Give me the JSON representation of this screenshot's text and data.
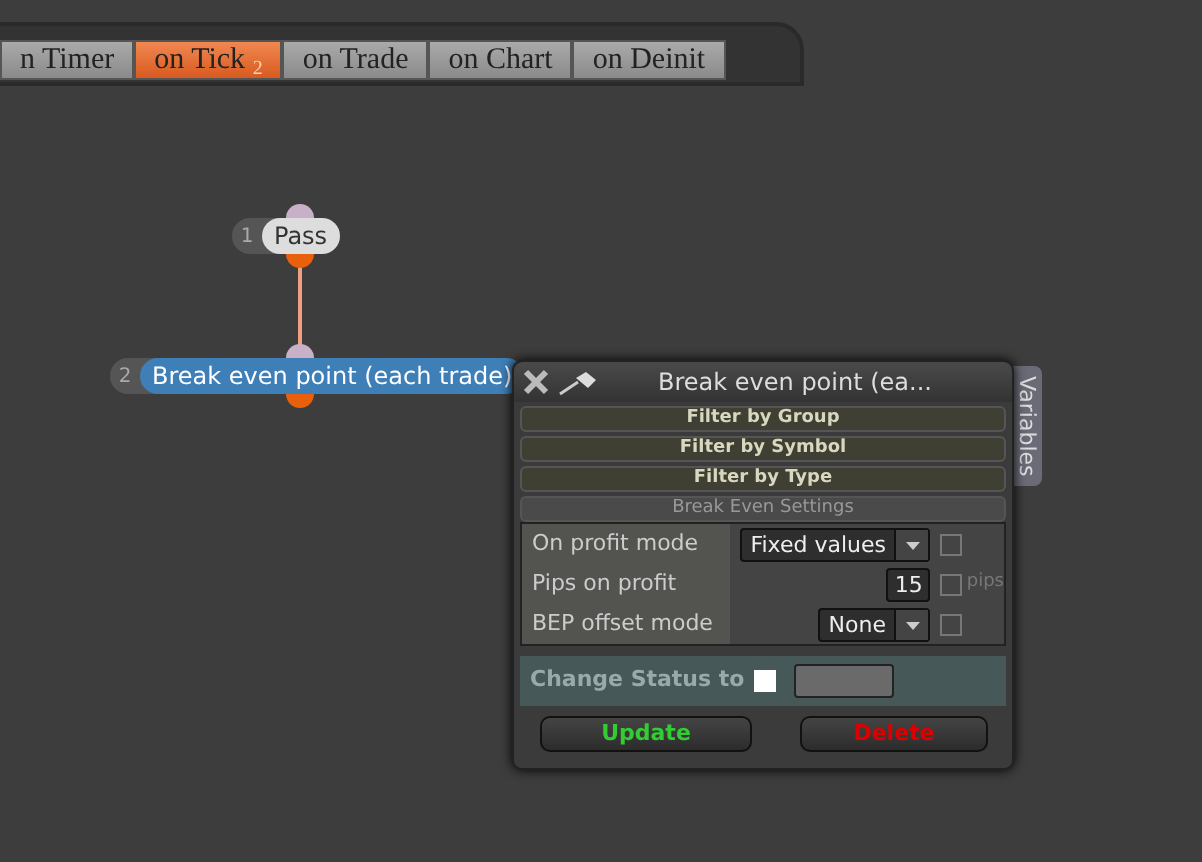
{
  "tabs": [
    {
      "label": "n Timer",
      "selected": false
    },
    {
      "label": "on Tick",
      "badge": "2",
      "selected": true
    },
    {
      "label": "on Trade",
      "selected": false
    },
    {
      "label": "on Chart",
      "selected": false
    },
    {
      "label": "on Deinit",
      "selected": false
    }
  ],
  "nodes": [
    {
      "number": "1",
      "label": "Pass",
      "selected": false
    },
    {
      "number": "2",
      "label": "Break even point (each trade)",
      "selected": true
    }
  ],
  "panel": {
    "title": "Break even point (ea...",
    "side_tab": "Variables",
    "filters": [
      "Filter by Group",
      "Filter by Symbol",
      "Filter by Type"
    ],
    "section": "Break Even Settings",
    "settings": [
      {
        "label": "On profit mode",
        "kind": "select",
        "value": "Fixed values",
        "checked": false
      },
      {
        "label": "Pips on profit",
        "kind": "number",
        "value": "15",
        "checked": false,
        "unit": "pips"
      },
      {
        "label": "BEP offset mode",
        "kind": "select",
        "value": "None",
        "checked": false
      }
    ],
    "status": {
      "label": "Change Status to",
      "checked": false
    },
    "buttons": [
      {
        "label": "Update",
        "kind": "update"
      },
      {
        "label": "Delete",
        "kind": "delete"
      }
    ]
  }
}
